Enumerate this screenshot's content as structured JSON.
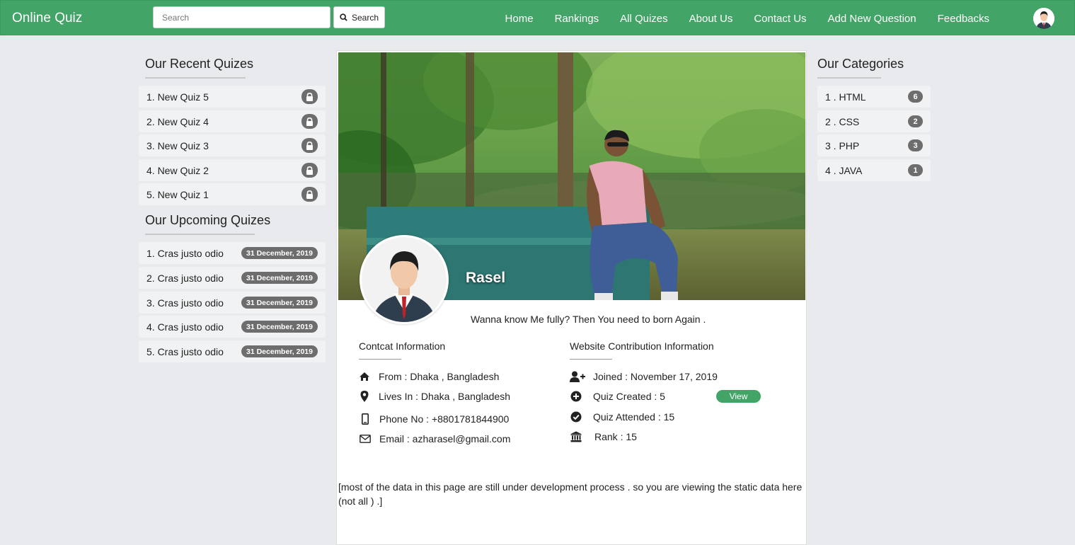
{
  "navbar": {
    "brand": "Online Quiz",
    "search_placeholder": "Search",
    "search_button": "Search",
    "links": [
      "Home",
      "Rankings",
      "All Quizes",
      "About Us",
      "Contact Us",
      "Add New Question",
      "Feedbacks"
    ]
  },
  "recent": {
    "title": "Our Recent Quizes",
    "items": [
      "1. New Quiz 5",
      "2. New Quiz 4",
      "3. New Quiz 3",
      "4. New Quiz 2",
      "5. New Quiz 1"
    ]
  },
  "upcoming": {
    "title": "Our Upcoming Quizes",
    "items": [
      {
        "label": "1. Cras justo odio",
        "date": "31 December, 2019"
      },
      {
        "label": "2. Cras justo odio",
        "date": "31 December, 2019"
      },
      {
        "label": "3. Cras justo odio",
        "date": "31 December, 2019"
      },
      {
        "label": "4. Cras justo odio",
        "date": "31 December, 2019"
      },
      {
        "label": "5. Cras justo odio",
        "date": "31 December, 2019"
      }
    ]
  },
  "categories": {
    "title": "Our Categories",
    "items": [
      {
        "label": "1 . HTML",
        "count": "6"
      },
      {
        "label": "2 . CSS",
        "count": "2"
      },
      {
        "label": "3 . PHP",
        "count": "3"
      },
      {
        "label": "4 . JAVA",
        "count": "1"
      }
    ]
  },
  "profile": {
    "name": "Rasel",
    "bio": "Wanna know Me fully? Then You need to born Again .",
    "contact_title": "Contcat Information",
    "contact": {
      "from": "From : Dhaka , Bangladesh",
      "lives": "Lives In : Dhaka , Bangladesh",
      "phone": "Phone No : +8801781844900",
      "email": "Email : azharasel@gmail.com"
    },
    "contrib_title": "Website Contribution Information",
    "contrib": {
      "joined": "Joined : November 17, 2019",
      "created": "Quiz Created : 5",
      "attended": "Quiz Attended : 15",
      "rank": "Rank : 15"
    },
    "view_button": "View",
    "note": "[most of the data in this page are still under development process . so you are viewing the static data here (not all ) .]"
  },
  "colors": {
    "primary": "#43a467",
    "badge": "#6d6d6d",
    "background": "#e9eaee"
  },
  "icons": {
    "search": "search-icon",
    "lock": "lock-icon",
    "home": "home-icon",
    "location": "map-marker-icon",
    "phone": "mobile-phone-icon",
    "email": "envelope-icon",
    "joined": "user-plus-icon",
    "created": "plus-circle-icon",
    "attended": "check-circle-icon",
    "rank": "bank-icon"
  }
}
